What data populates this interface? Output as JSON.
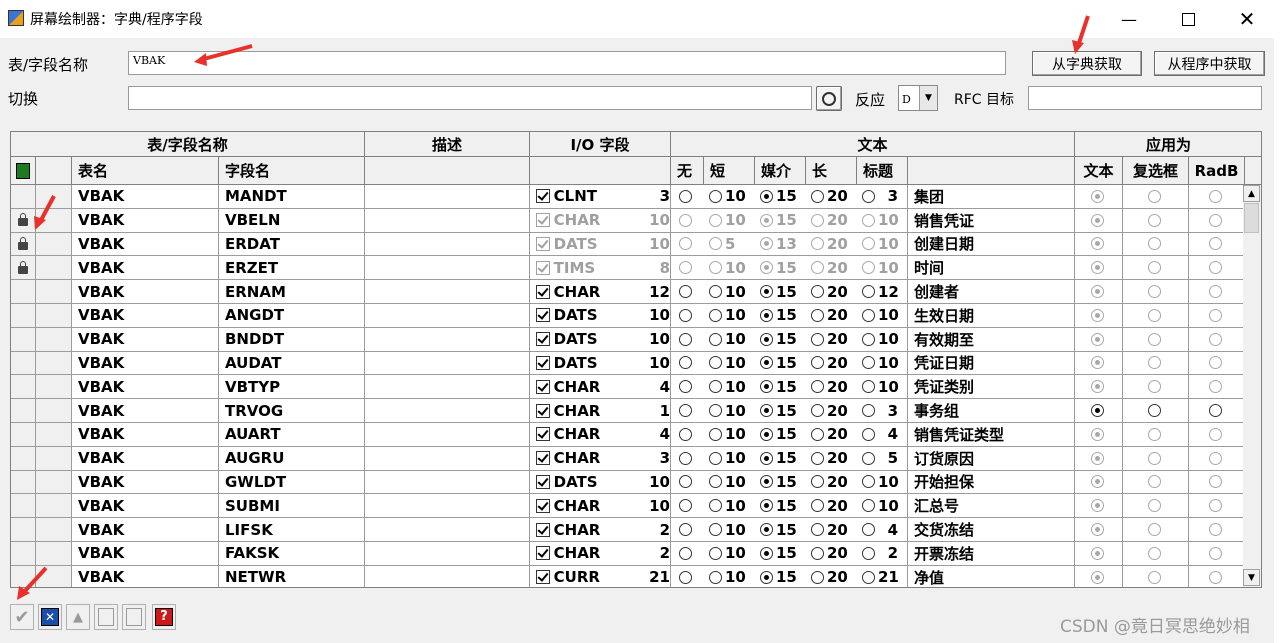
{
  "window": {
    "title": "屏幕绘制器：字典/程序字段"
  },
  "form": {
    "field_label": "表/字段名称",
    "field_value": "VBAK",
    "switch_label": "切换",
    "switch_value": "",
    "reaction_label": "反应",
    "reaction_value": "D",
    "rfc_label": "RFC 目标",
    "rfc_value": "",
    "btn_dict": "从字典获取",
    "btn_program": "从程序中获取"
  },
  "grid": {
    "group_headers": [
      "表/字段名称",
      "描述",
      "I/O 字段",
      "文本",
      "应用为"
    ],
    "sub_headers": {
      "table": "表名",
      "field": "字段名",
      "none": "无",
      "short": "短",
      "medium": "媒介",
      "long": "长",
      "heading": "标题",
      "as_text": "文本",
      "as_checkbox": "复选框",
      "as_radio": "RadB"
    },
    "rows": [
      {
        "lock": false,
        "table": "VBAK",
        "field": "MANDT",
        "type": "CLNT",
        "len": "3",
        "dis": false,
        "l10": "10",
        "l15": "15",
        "l20": "20",
        "hd": "3",
        "sel": "15",
        "text": "集团",
        "app": "text",
        "app_dis": true
      },
      {
        "lock": true,
        "table": "VBAK",
        "field": "VBELN",
        "type": "CHAR",
        "len": "10",
        "dis": true,
        "l10": "10",
        "l15": "15",
        "l20": "20",
        "hd": "10",
        "sel": "15",
        "text": "销售凭证",
        "app": "text",
        "app_dis": true
      },
      {
        "lock": true,
        "table": "VBAK",
        "field": "ERDAT",
        "type": "DATS",
        "len": "10",
        "dis": true,
        "l10": "",
        "l10b": "5",
        "l15": "13",
        "l20": "20",
        "hd": "10",
        "sel": "15",
        "text": "创建日期",
        "app": "text",
        "app_dis": true
      },
      {
        "lock": true,
        "table": "VBAK",
        "field": "ERZET",
        "type": "TIMS",
        "len": "8",
        "dis": true,
        "l10": "10",
        "l15": "15",
        "l20": "20",
        "hd": "10",
        "sel": "15",
        "text": "时间",
        "app": "text",
        "app_dis": true
      },
      {
        "lock": false,
        "table": "VBAK",
        "field": "ERNAM",
        "type": "CHAR",
        "len": "12",
        "dis": false,
        "l10": "10",
        "l15": "15",
        "l20": "20",
        "hd": "12",
        "sel": "15",
        "text": "创建者",
        "app": "text",
        "app_dis": true
      },
      {
        "lock": false,
        "table": "VBAK",
        "field": "ANGDT",
        "type": "DATS",
        "len": "10",
        "dis": false,
        "l10": "10",
        "l15": "15",
        "l20": "20",
        "hd": "10",
        "sel": "15",
        "text": "生效日期",
        "app": "text",
        "app_dis": true
      },
      {
        "lock": false,
        "table": "VBAK",
        "field": "BNDDT",
        "type": "DATS",
        "len": "10",
        "dis": false,
        "l10": "10",
        "l15": "15",
        "l20": "20",
        "hd": "10",
        "sel": "15",
        "text": "有效期至",
        "app": "text",
        "app_dis": true
      },
      {
        "lock": false,
        "table": "VBAK",
        "field": "AUDAT",
        "type": "DATS",
        "len": "10",
        "dis": false,
        "l10": "10",
        "l15": "15",
        "l20": "20",
        "hd": "10",
        "sel": "15",
        "text": "凭证日期",
        "app": "text",
        "app_dis": true
      },
      {
        "lock": false,
        "table": "VBAK",
        "field": "VBTYP",
        "type": "CHAR",
        "len": "4",
        "dis": false,
        "l10": "10",
        "l15": "15",
        "l20": "20",
        "hd": "10",
        "sel": "15",
        "text": "凭证类别",
        "app": "text",
        "app_dis": true
      },
      {
        "lock": false,
        "table": "VBAK",
        "field": "TRVOG",
        "type": "CHAR",
        "len": "1",
        "dis": false,
        "l10": "10",
        "l15": "15",
        "l20": "20",
        "hd": "3",
        "sel": "15",
        "text": "事务组",
        "app": "text",
        "app_dis": false
      },
      {
        "lock": false,
        "table": "VBAK",
        "field": "AUART",
        "type": "CHAR",
        "len": "4",
        "dis": false,
        "l10": "10",
        "l15": "15",
        "l20": "20",
        "hd": "4",
        "sel": "15",
        "text": "销售凭证类型",
        "app": "text",
        "app_dis": true
      },
      {
        "lock": false,
        "table": "VBAK",
        "field": "AUGRU",
        "type": "CHAR",
        "len": "3",
        "dis": false,
        "l10": "10",
        "l15": "15",
        "l20": "20",
        "hd": "5",
        "sel": "15",
        "text": "订货原因",
        "app": "text",
        "app_dis": true
      },
      {
        "lock": false,
        "table": "VBAK",
        "field": "GWLDT",
        "type": "DATS",
        "len": "10",
        "dis": false,
        "l10": "10",
        "l15": "15",
        "l20": "20",
        "hd": "10",
        "sel": "15",
        "text": "开始担保",
        "app": "text",
        "app_dis": true
      },
      {
        "lock": false,
        "table": "VBAK",
        "field": "SUBMI",
        "type": "CHAR",
        "len": "10",
        "dis": false,
        "l10": "10",
        "l15": "15",
        "l20": "20",
        "hd": "10",
        "sel": "15",
        "text": "汇总号",
        "app": "text",
        "app_dis": true
      },
      {
        "lock": false,
        "table": "VBAK",
        "field": "LIFSK",
        "type": "CHAR",
        "len": "2",
        "dis": false,
        "l10": "10",
        "l15": "15",
        "l20": "20",
        "hd": "4",
        "sel": "15",
        "text": "交货冻结",
        "app": "text",
        "app_dis": true
      },
      {
        "lock": false,
        "table": "VBAK",
        "field": "FAKSK",
        "type": "CHAR",
        "len": "2",
        "dis": false,
        "l10": "10",
        "l15": "15",
        "l20": "20",
        "hd": "2",
        "sel": "15",
        "text": "开票冻结",
        "app": "text",
        "app_dis": true
      },
      {
        "lock": false,
        "table": "VBAK",
        "field": "NETWR",
        "type": "CURR",
        "len": "21",
        "dis": false,
        "l10": "10",
        "l15": "15",
        "l20": "20",
        "hd": "21",
        "sel": "15",
        "text": "净值",
        "app": "text",
        "app_dis": true
      }
    ]
  },
  "toolbar": {
    "icons": [
      "check-icon",
      "cancel-icon",
      "transfer-icon",
      "save-icon",
      "save-disabled-icon",
      "help-icon"
    ]
  },
  "watermark": "CSDN @竟日冥思绝妙相",
  "colors": {
    "arrow": "#e8312a",
    "accent": "#1a4ea8"
  }
}
